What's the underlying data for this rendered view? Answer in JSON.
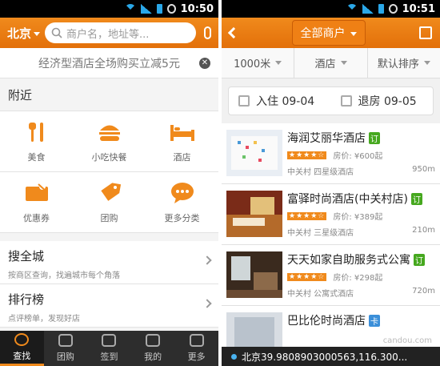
{
  "left": {
    "time": "10:50",
    "city": "北京",
    "search_placeholder": "商户名，地址等...",
    "promo": "经济型酒店全场购买立减5元",
    "nearby_title": "附近",
    "categories": [
      {
        "label": "美食",
        "icon": "fork-knife-icon"
      },
      {
        "label": "小吃快餐",
        "icon": "burger-icon"
      },
      {
        "label": "酒店",
        "icon": "bed-icon"
      },
      {
        "label": "优惠券",
        "icon": "coupon-icon"
      },
      {
        "label": "团购",
        "icon": "tag-icon"
      },
      {
        "label": "更多分类",
        "icon": "chat-bubble-icon"
      }
    ],
    "rows": [
      {
        "title": "搜全城",
        "subtitle": "按商区查询，找遍城市每个角落"
      },
      {
        "title": "排行榜",
        "subtitle": "点评榜单，发现好店"
      }
    ],
    "tabs": [
      "查找",
      "团购",
      "签到",
      "我的",
      "更多"
    ],
    "accent": "#f08a1c"
  },
  "right": {
    "time": "10:51",
    "header_title": "全部商户",
    "filters": [
      "1000米",
      "酒店",
      "默认排序"
    ],
    "checkin": "入住 09-04",
    "checkout": "退房 09-05",
    "hotels": [
      {
        "name": "海润艾丽华酒店",
        "badge": "订",
        "badge_color": "#46a81f",
        "price": "房价: ¥600起",
        "area": "中关村 四星级酒店",
        "distance": "950m"
      },
      {
        "name": "富驿时尚酒店(中关村店)",
        "badge": "订",
        "badge_color": "#46a81f",
        "price": "房价: ¥389起",
        "area": "中关村 三星级酒店",
        "distance": "210m"
      },
      {
        "name": "天天如家自助服务式公寓",
        "badge": "订",
        "badge_color": "#46a81f",
        "price": "房价: ¥298起",
        "area": "中关村 公寓式酒店",
        "distance": "720m"
      },
      {
        "name": "巴比伦时尚酒店",
        "badge": "卡",
        "badge_color": "#3b8fd9",
        "price": "",
        "area": "",
        "distance": ""
      }
    ],
    "location": "北京39.9808903000563,116.300...",
    "watermark": "candou.com"
  }
}
